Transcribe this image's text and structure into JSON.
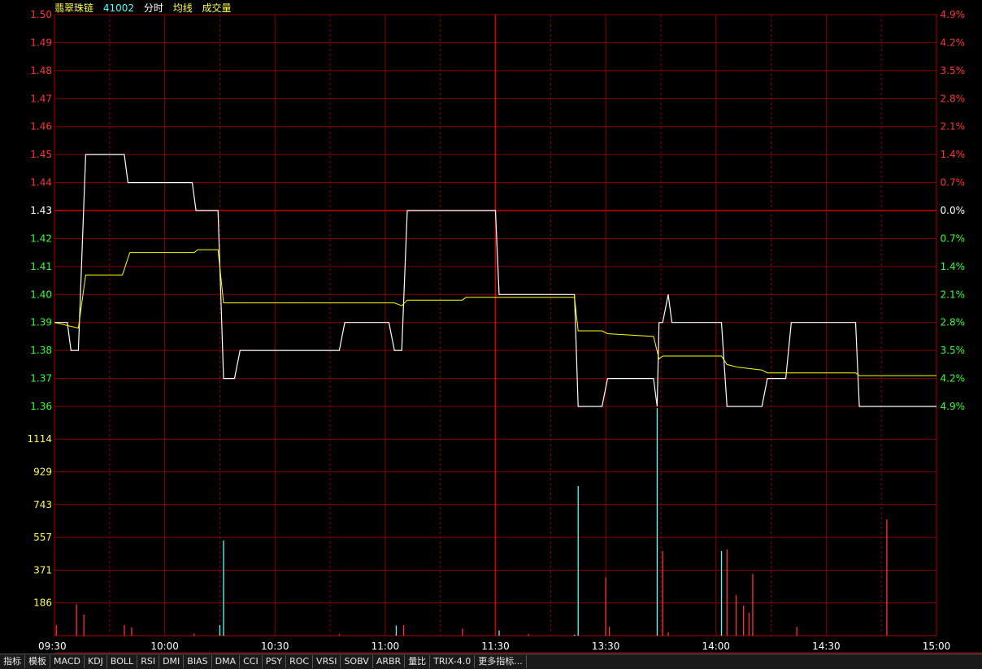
{
  "header": {
    "name": "翡翠珠链",
    "code": "41002",
    "mode": "分时",
    "avg_label": "均线",
    "vol_label": "成交量"
  },
  "colors": {
    "up": "#ff3333",
    "down": "#33ff33",
    "flat": "#ffffff",
    "grid": "#8b0000",
    "grid_major": "#b00000",
    "price": "#ffffff",
    "avg": "#ffff00",
    "vol_up": "#ff3333",
    "vol_down": "#54ffff",
    "vol_axis": "#ffff54"
  },
  "tabs": [
    "指标",
    "模板",
    "MACD",
    "KDJ",
    "BOLL",
    "RSI",
    "DMI",
    "BIAS",
    "DMA",
    "CCI",
    "PSY",
    "ROC",
    "VRSI",
    "SOBV",
    "ARBR",
    "量比",
    "TRIX-4.0",
    "更多指标..."
  ],
  "chart_data": {
    "type": "line",
    "prev_close": 1.43,
    "price_axis": {
      "left_ticks": [
        "1.50",
        "1.49",
        "1.48",
        "1.47",
        "1.46",
        "1.45",
        "1.44",
        "1.43",
        "1.42",
        "1.41",
        "1.40",
        "1.39",
        "1.38",
        "1.37",
        "1.36"
      ],
      "right_ticks": [
        "4.9%",
        "4.2%",
        "3.5%",
        "2.8%",
        "2.1%",
        "1.4%",
        "0.7%",
        "0.0%",
        "0.7%",
        "1.4%",
        "2.1%",
        "2.8%",
        "3.5%",
        "4.2%",
        "4.9%"
      ],
      "ylim": [
        1.36,
        1.5
      ]
    },
    "volume_axis": {
      "ticks": [
        "1114",
        "929",
        "743",
        "557",
        "371",
        "186"
      ],
      "ylim": [
        0,
        1300
      ]
    },
    "time_labels": [
      "09:30",
      "10:00",
      "10:30",
      "11:00",
      "11:30",
      "13:30",
      "14:00",
      "14:30",
      "15:00"
    ],
    "price_series": [
      [
        0,
        1.39
      ],
      [
        7,
        1.39
      ],
      [
        9,
        1.38
      ],
      [
        13,
        1.38
      ],
      [
        17,
        1.45
      ],
      [
        38,
        1.45
      ],
      [
        40,
        1.44
      ],
      [
        75,
        1.44
      ],
      [
        77,
        1.43
      ],
      [
        89,
        1.43
      ],
      [
        92,
        1.37
      ],
      [
        98,
        1.37
      ],
      [
        101,
        1.38
      ],
      [
        155,
        1.38
      ],
      [
        158,
        1.39
      ],
      [
        182,
        1.39
      ],
      [
        185,
        1.38
      ],
      [
        189,
        1.38
      ],
      [
        192,
        1.43
      ],
      [
        240,
        1.43
      ],
      [
        242,
        1.4
      ],
      [
        283,
        1.4
      ],
      [
        285,
        1.36
      ],
      [
        298,
        1.36
      ],
      [
        301,
        1.37
      ],
      [
        326,
        1.37
      ],
      [
        328,
        1.36
      ],
      [
        329,
        1.39
      ],
      [
        331,
        1.39
      ],
      [
        334,
        1.4
      ],
      [
        336,
        1.39
      ],
      [
        363,
        1.39
      ],
      [
        366,
        1.36
      ],
      [
        385,
        1.36
      ],
      [
        388,
        1.37
      ],
      [
        398,
        1.37
      ],
      [
        401,
        1.39
      ],
      [
        436,
        1.39
      ],
      [
        438,
        1.36
      ],
      [
        480,
        1.36
      ]
    ],
    "avg_series": [
      [
        0,
        1.39
      ],
      [
        13,
        1.388
      ],
      [
        17,
        1.407
      ],
      [
        37,
        1.407
      ],
      [
        41,
        1.415
      ],
      [
        76,
        1.415
      ],
      [
        78,
        1.416
      ],
      [
        89,
        1.416
      ],
      [
        92,
        1.397
      ],
      [
        185,
        1.397
      ],
      [
        189,
        1.396
      ],
      [
        192,
        1.398
      ],
      [
        222,
        1.398
      ],
      [
        224,
        1.399
      ],
      [
        283,
        1.399
      ],
      [
        285,
        1.387
      ],
      [
        298,
        1.387
      ],
      [
        301,
        1.386
      ],
      [
        326,
        1.385
      ],
      [
        329,
        1.377
      ],
      [
        331,
        1.378
      ],
      [
        363,
        1.378
      ],
      [
        366,
        1.375
      ],
      [
        372,
        1.374
      ],
      [
        385,
        1.373
      ],
      [
        388,
        1.372
      ],
      [
        436,
        1.372
      ],
      [
        438,
        1.371
      ],
      [
        480,
        1.371
      ]
    ],
    "volume_series": [
      [
        1,
        60,
        "up"
      ],
      [
        12,
        178,
        "up"
      ],
      [
        16,
        120,
        "up"
      ],
      [
        38,
        60,
        "up"
      ],
      [
        42,
        48,
        "up"
      ],
      [
        76,
        12,
        "up"
      ],
      [
        90,
        60,
        "down"
      ],
      [
        92,
        540,
        "down"
      ],
      [
        155,
        8,
        "up"
      ],
      [
        186,
        58,
        "down"
      ],
      [
        190,
        60,
        "up"
      ],
      [
        222,
        40,
        "up"
      ],
      [
        242,
        30,
        "down"
      ],
      [
        258,
        10,
        "up"
      ],
      [
        283,
        6,
        "down"
      ],
      [
        285,
        850,
        "down"
      ],
      [
        300,
        330,
        "up"
      ],
      [
        302,
        50,
        "up"
      ],
      [
        328,
        1320,
        "down"
      ],
      [
        331,
        480,
        "up"
      ],
      [
        334,
        20,
        "up"
      ],
      [
        363,
        480,
        "down"
      ],
      [
        366,
        490,
        "up"
      ],
      [
        371,
        230,
        "up"
      ],
      [
        375,
        170,
        "up"
      ],
      [
        378,
        130,
        "up"
      ],
      [
        380,
        350,
        "up"
      ],
      [
        404,
        50,
        "up"
      ],
      [
        453,
        660,
        "up"
      ]
    ]
  }
}
